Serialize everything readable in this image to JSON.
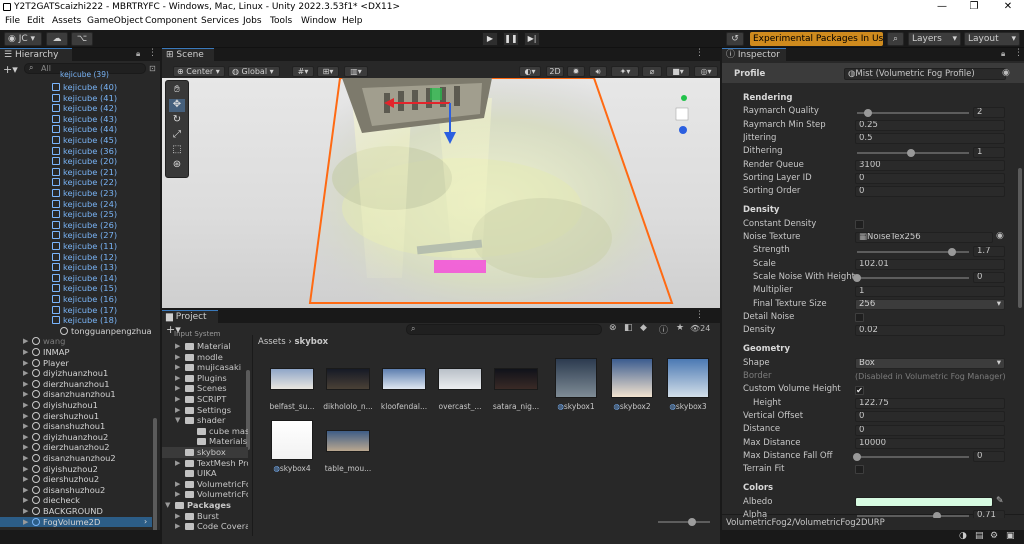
{
  "window": {
    "title": "Y2T2GATScaizhi222 - MBRTRYFC - Windows, Mac, Linux - Unity 2022.3.53f1* <DX11>"
  },
  "menu": [
    "File",
    "Edit",
    "Assets",
    "GameObject",
    "Component",
    "Services",
    "Jobs",
    "Tools",
    "Window",
    "Help"
  ],
  "toolbar": {
    "account": "JC",
    "experimental": "Experimental Packages In Use",
    "layers": "Layers",
    "layout": "Layout"
  },
  "hierarchy": {
    "tab": "Hierarchy",
    "search_placeholder": "All",
    "rows": [
      {
        "label": "kejicube (40)",
        "kind": "blue"
      },
      {
        "label": "kejicube (41)",
        "kind": "blue"
      },
      {
        "label": "kejicube (42)",
        "kind": "blue"
      },
      {
        "label": "kejicube (43)",
        "kind": "blue"
      },
      {
        "label": "kejicube (44)",
        "kind": "blue"
      },
      {
        "label": "kejicube (45)",
        "kind": "blue"
      },
      {
        "label": "kejicube (36)",
        "kind": "blue"
      },
      {
        "label": "kejicube (20)",
        "kind": "blue"
      },
      {
        "label": "kejicube (21)",
        "kind": "blue"
      },
      {
        "label": "kejicube (22)",
        "kind": "blue"
      },
      {
        "label": "kejicube (23)",
        "kind": "blue"
      },
      {
        "label": "kejicube (24)",
        "kind": "blue"
      },
      {
        "label": "kejicube (25)",
        "kind": "blue"
      },
      {
        "label": "kejicube (26)",
        "kind": "blue"
      },
      {
        "label": "kejicube (27)",
        "kind": "blue"
      },
      {
        "label": "kejicube (11)",
        "kind": "blue"
      },
      {
        "label": "kejicube (12)",
        "kind": "blue"
      },
      {
        "label": "kejicube (13)",
        "kind": "blue"
      },
      {
        "label": "kejicube (14)",
        "kind": "blue"
      },
      {
        "label": "kejicube (15)",
        "kind": "blue"
      },
      {
        "label": "kejicube (16)",
        "kind": "blue"
      },
      {
        "label": "kejicube (17)",
        "kind": "blue"
      },
      {
        "label": "kejicube (18)",
        "kind": "blue"
      },
      {
        "label": "tongguanpengzhuan",
        "kind": "white"
      },
      {
        "label": "wang",
        "kind": "gray"
      },
      {
        "label": "INMAP",
        "kind": "white"
      },
      {
        "label": "Player",
        "kind": "white"
      },
      {
        "label": "diyizhuanzhou1",
        "kind": "white"
      },
      {
        "label": "dierzhuanzhou1",
        "kind": "white"
      },
      {
        "label": "disanzhuanzhou1",
        "kind": "white"
      },
      {
        "label": "diyishuzhou1",
        "kind": "white"
      },
      {
        "label": "diershuzhou1",
        "kind": "white"
      },
      {
        "label": "disanshuzhou1",
        "kind": "white"
      },
      {
        "label": "diyizhuanzhou2",
        "kind": "white"
      },
      {
        "label": "dierzhuanzhou2",
        "kind": "white"
      },
      {
        "label": "disanzhuanzhou2",
        "kind": "white"
      },
      {
        "label": "diyishuzhou2",
        "kind": "white"
      },
      {
        "label": "diershuzhou2",
        "kind": "white"
      },
      {
        "label": "disanshuzhou2",
        "kind": "white"
      },
      {
        "label": "diecheck",
        "kind": "white"
      },
      {
        "label": "BACKGROUND",
        "kind": "white"
      },
      {
        "label": "FogVolume2D",
        "kind": "selected"
      }
    ]
  },
  "scene": {
    "tab": "Scene",
    "pivot": "Center",
    "space": "Global",
    "mode2d": "2D"
  },
  "project": {
    "tab": "Project",
    "breadcrumb_root": "Assets",
    "breadcrumb_leaf": "skybox",
    "count": "24",
    "tree": [
      {
        "label": "Material",
        "indent": 1
      },
      {
        "label": "modle",
        "indent": 1
      },
      {
        "label": "mujicasaki",
        "indent": 1
      },
      {
        "label": "Plugins",
        "indent": 1
      },
      {
        "label": "Scenes",
        "indent": 1
      },
      {
        "label": "SCRIPT",
        "indent": 1
      },
      {
        "label": "Settings",
        "indent": 1
      },
      {
        "label": "shader",
        "indent": 1
      },
      {
        "label": "cube mask",
        "indent": 2
      },
      {
        "label": "Materials",
        "indent": 2
      },
      {
        "label": "skybox",
        "indent": 1
      },
      {
        "label": "TextMesh Pro",
        "indent": 1
      },
      {
        "label": "UIKA",
        "indent": 1
      },
      {
        "label": "VolumetricFog",
        "indent": 1
      },
      {
        "label": "VolumetricFog",
        "indent": 1
      },
      {
        "label": "Packages",
        "indent": 0
      },
      {
        "label": "Burst",
        "indent": 1
      },
      {
        "label": "Code Coverage",
        "indent": 1
      }
    ],
    "assets": [
      {
        "label": "belfast_su...",
        "c1": "#8fa6c8",
        "c2": "#e9e6df"
      },
      {
        "label": "dikhololo_n...",
        "c1": "#161a26",
        "c2": "#4a4136"
      },
      {
        "label": "kloofendal...",
        "c1": "#5e7fb0",
        "c2": "#dfe7f1"
      },
      {
        "label": "overcast_...",
        "c1": "#b9c0c8",
        "c2": "#eceef0"
      },
      {
        "label": "satara_nig...",
        "c1": "#10121a",
        "c2": "#3a2a26"
      },
      {
        "label": "skybox1",
        "c1": "#2c3b4f",
        "c2": "#7f8c96"
      },
      {
        "label": "skybox2",
        "c1": "#3b5c8f",
        "c2": "#f2e3cf"
      },
      {
        "label": "skybox3",
        "c1": "#4b79b3",
        "c2": "#d3dfe9"
      },
      {
        "label": "skybox4",
        "c1": "#ffffff",
        "c2": "#f2f2f2"
      },
      {
        "label": "table_mou...",
        "c1": "#3e5d86",
        "c2": "#b9a78f"
      }
    ],
    "footer": "VolumetricFog2/VolumetricFog2DURP"
  },
  "inspector": {
    "tab": "Inspector",
    "profile_label": "Profile",
    "profile_value": "Mist (Volumetric Fog Profile)",
    "sections": [
      {
        "title": "Rendering",
        "rows": [
          {
            "label": "Raymarch Quality",
            "type": "slider",
            "value": "2",
            "pos": 0.1
          },
          {
            "label": "Raymarch Min Step",
            "type": "field",
            "value": "0.25"
          },
          {
            "label": "Jittering",
            "type": "field",
            "value": "0.5"
          },
          {
            "label": "Dithering",
            "type": "slider",
            "value": "1",
            "pos": 0.48
          },
          {
            "label": "Render Queue",
            "type": "field",
            "value": "3100"
          },
          {
            "label": "Sorting Layer ID",
            "type": "field",
            "value": "0"
          },
          {
            "label": "Sorting Order",
            "type": "field",
            "value": "0"
          }
        ]
      },
      {
        "title": "Density",
        "rows": [
          {
            "label": "Constant Density",
            "type": "check",
            "value": ""
          },
          {
            "label": "Noise Texture",
            "type": "object",
            "value": "NoiseTex256"
          },
          {
            "label": "Strength",
            "type": "slider",
            "value": "1.7",
            "pos": 0.85,
            "indent": true
          },
          {
            "label": "Scale",
            "type": "field",
            "value": "102.01",
            "indent": true
          },
          {
            "label": "Scale Noise With Height",
            "type": "slider",
            "value": "0",
            "pos": 0.0,
            "indent": true
          },
          {
            "label": "Multiplier",
            "type": "field",
            "value": "1",
            "indent": true
          },
          {
            "label": "Final Texture Size",
            "type": "dropdown",
            "value": "256",
            "indent": true
          },
          {
            "label": "Detail Noise",
            "type": "check",
            "value": ""
          },
          {
            "label": "Density",
            "type": "field",
            "value": "0.02"
          }
        ]
      },
      {
        "title": "Geometry",
        "rows": [
          {
            "label": "Shape",
            "type": "dropdown",
            "value": "Box"
          },
          {
            "label": "Border",
            "type": "dimtext",
            "value": "(Disabled in Volumetric Fog Manager)",
            "dim": true
          },
          {
            "label": "Custom Volume Height",
            "type": "check",
            "value": "✔"
          },
          {
            "label": "Height",
            "type": "field",
            "value": "122.75",
            "indent": true
          },
          {
            "label": "Vertical Offset",
            "type": "field",
            "value": "0"
          },
          {
            "label": "Distance",
            "type": "field",
            "value": "0"
          },
          {
            "label": "Max Distance",
            "type": "field",
            "value": "10000"
          },
          {
            "label": "Max Distance Fall Off",
            "type": "slider",
            "value": "0",
            "pos": 0.0
          },
          {
            "label": "Terrain Fit",
            "type": "check",
            "value": ""
          }
        ]
      },
      {
        "title": "Colors",
        "rows": [
          {
            "label": "Albedo",
            "type": "color",
            "value": "",
            "color": "#d8fbe2"
          },
          {
            "label": "Alpha",
            "type": "slider",
            "value": "0.71",
            "pos": 0.71
          }
        ]
      }
    ]
  }
}
